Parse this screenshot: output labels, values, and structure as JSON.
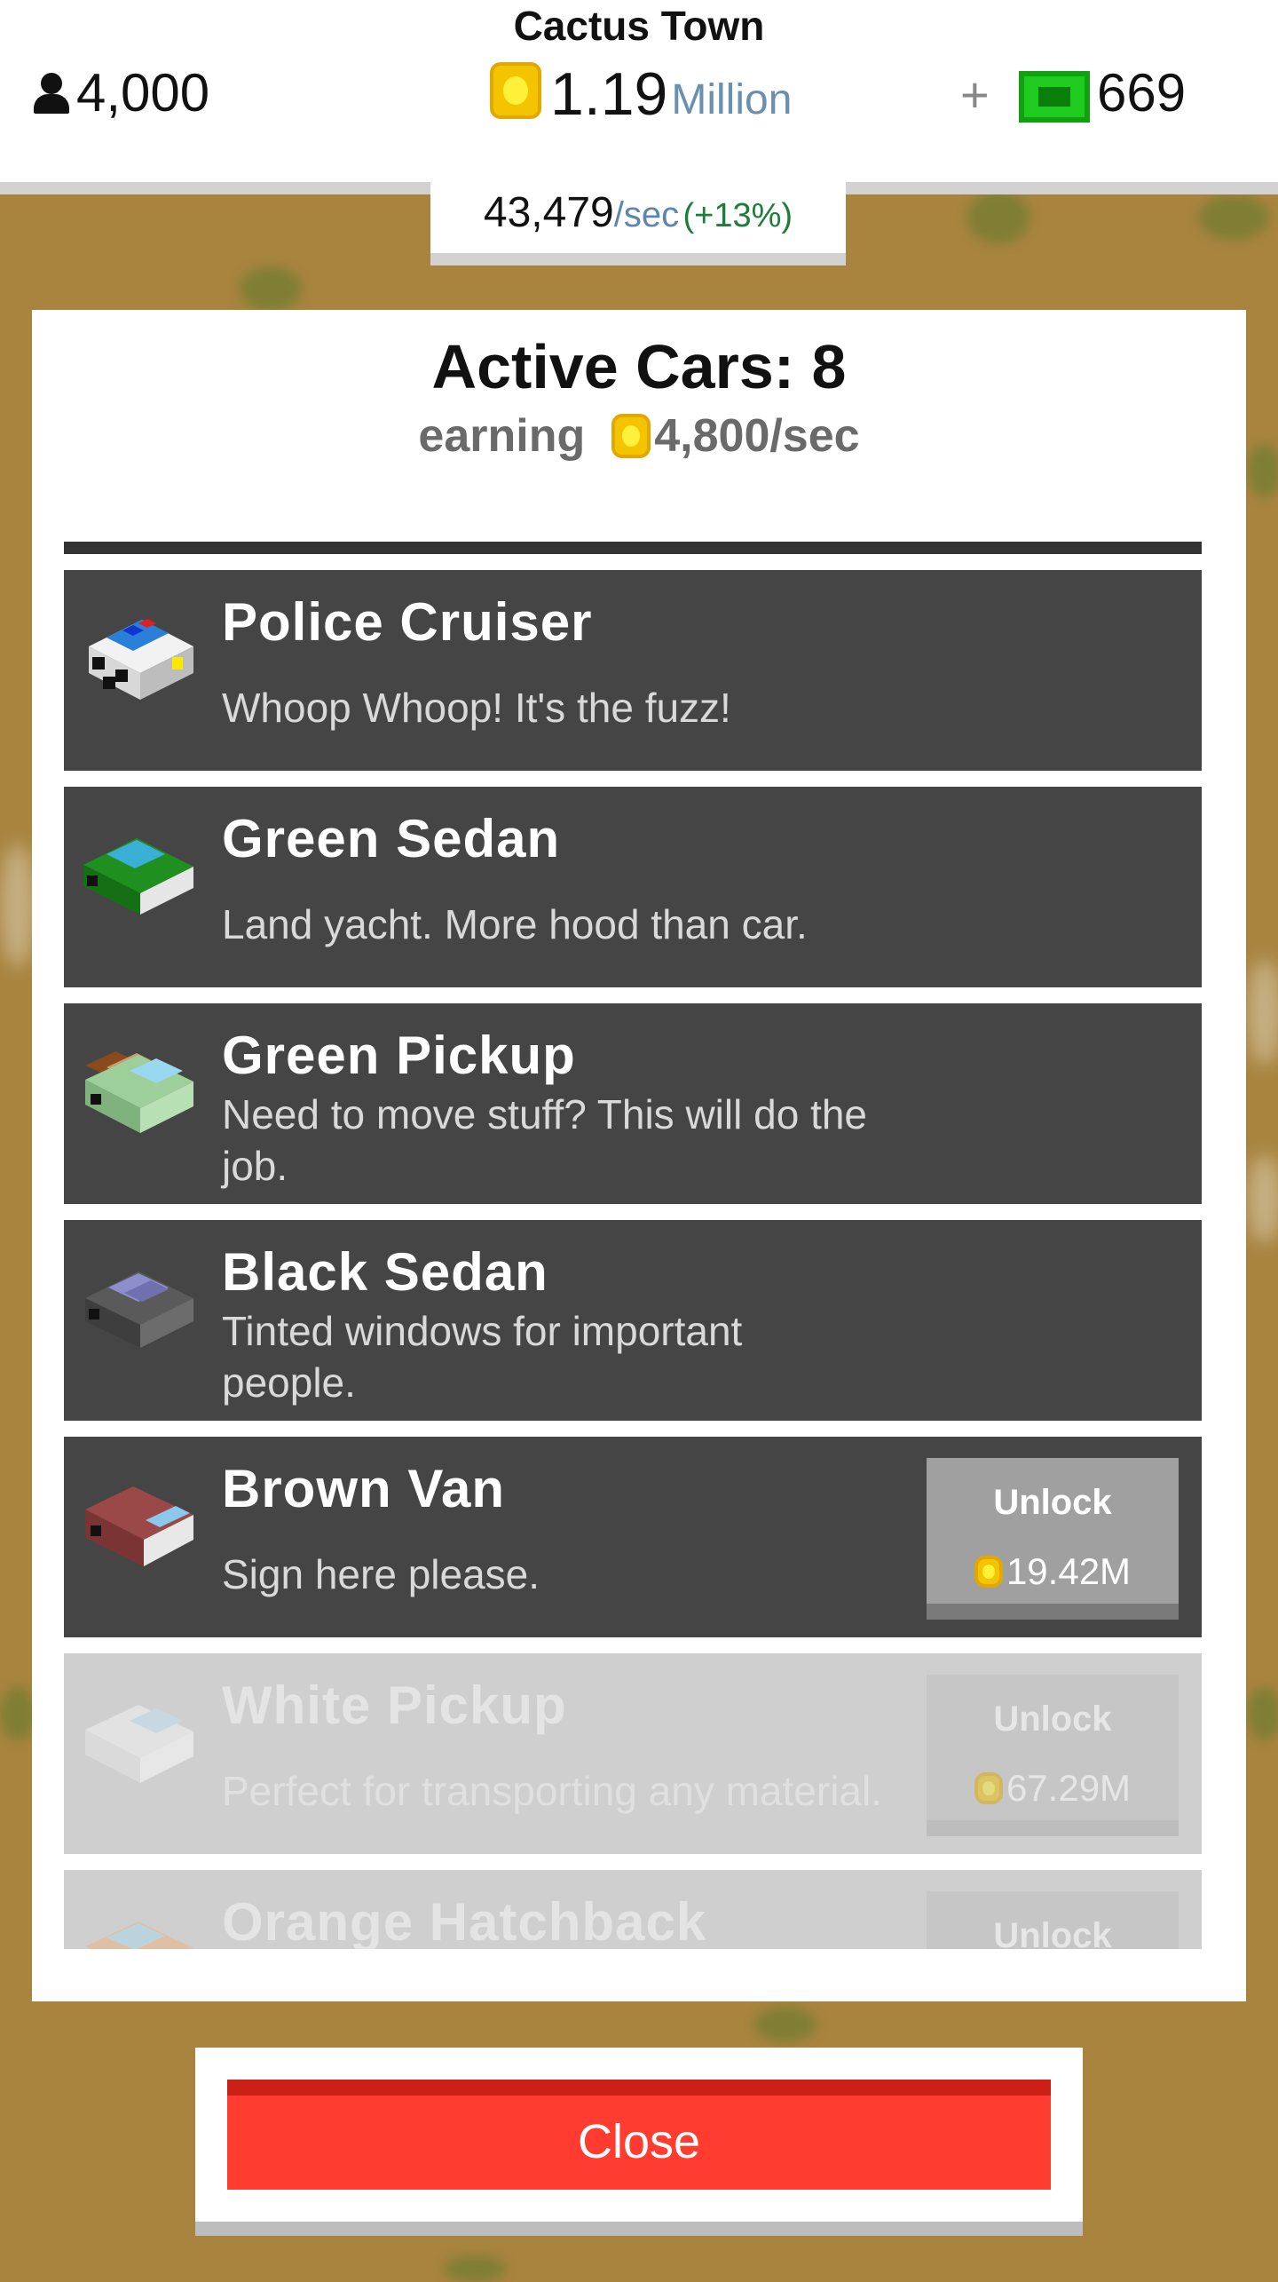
{
  "header": {
    "town_name": "Cactus Town",
    "population": "4,000",
    "money_value": "1.19",
    "money_unit": "Million",
    "plus": "+",
    "gems": "669",
    "rate_value": "43,479",
    "rate_unit": "/sec",
    "rate_percent": "(+13%)"
  },
  "panel": {
    "title": "Active Cars: 8",
    "earning_label": "earning",
    "earning_value": "4,800/sec"
  },
  "cars": [
    {
      "name": "Police Cruiser",
      "desc": "Whoop Whoop! It's the fuzz!",
      "icon": "police-car-icon",
      "locked": false
    },
    {
      "name": "Green Sedan",
      "desc": "Land yacht. More hood than car.",
      "icon": "green-sedan-icon",
      "locked": false
    },
    {
      "name": "Green Pickup",
      "desc": "Need to move stuff? This will do the job.",
      "icon": "green-pickup-icon",
      "locked": false
    },
    {
      "name": "Black Sedan",
      "desc": "Tinted windows for important people.",
      "icon": "black-sedan-icon",
      "locked": false
    },
    {
      "name": "Brown Van",
      "desc": "Sign here please.",
      "icon": "brown-van-icon",
      "locked": false,
      "unlock_label": "Unlock",
      "price": "19.42M"
    },
    {
      "name": "White Pickup",
      "desc": "Perfect for transporting any material.",
      "icon": "white-pickup-icon",
      "locked": true,
      "unlock_label": "Unlock",
      "price": "67.29M"
    },
    {
      "name": "Orange Hatchback",
      "desc": "",
      "icon": "orange-hatchback-icon",
      "locked": true,
      "unlock_label": "Unlock"
    }
  ],
  "close_label": "Close",
  "colors": {
    "accent_red": "#ff3c2f",
    "gem_green": "#1ecb1e",
    "coin_yellow": "#f5c400",
    "row_dark": "#454545"
  }
}
